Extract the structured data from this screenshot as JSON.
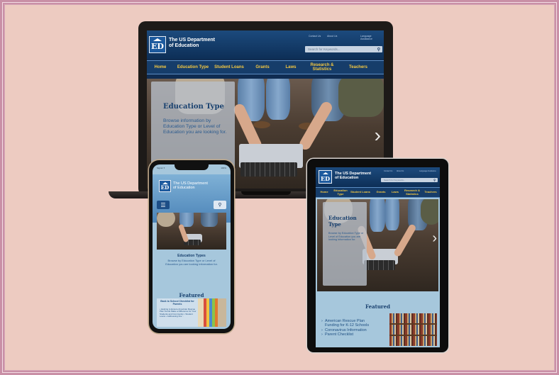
{
  "site": {
    "logo_text": "ED",
    "title_line1": "The US  Department",
    "title_line2": "of Education",
    "toplinks": [
      "Contact Us",
      "About Us",
      "Language Assistance"
    ],
    "search_placeholder": "Search for Keywords..."
  },
  "nav": [
    {
      "label": "Home"
    },
    {
      "label": "Education Type"
    },
    {
      "label": "Student Loans"
    },
    {
      "label": "Grants"
    },
    {
      "label": "Laws"
    },
    {
      "label": "Research & Statistics"
    },
    {
      "label": "Teachers"
    }
  ],
  "hero": {
    "heading": "Education Type",
    "body": "Browse information by Education Type or Level of Education you are looking for.",
    "next_arrow": "›"
  },
  "phone": {
    "status_left": "Signal ✦",
    "status_time": "9:41 AM",
    "status_right": "100%",
    "section_heading": "Education Types",
    "section_body": "Browse by Education Type or Level of Education you are looking information for.",
    "featured_heading": "Featured",
    "card_title": "Back to School Checklist for Parents",
    "card_items": "• Helping to Ensure American Rescue Plan Funds Make a Difference for Your Students and Community • Student Loans • Addressing Fra..."
  },
  "tablet": {
    "hero_heading": "Education Type",
    "hero_body": "Browse by Education Type or Level of Education you are looking information for.",
    "featured_heading": "Featured",
    "featured_items": [
      "American Rescue Plan Funding for K-12 Schools",
      "Coronavirus Information",
      "Parent Checklist"
    ]
  },
  "colors": {
    "header_blue": "#0d2f57",
    "nav_gold": "#f4c842",
    "light_blue": "#a6c7dc",
    "background_pink": "#edcbc1"
  }
}
